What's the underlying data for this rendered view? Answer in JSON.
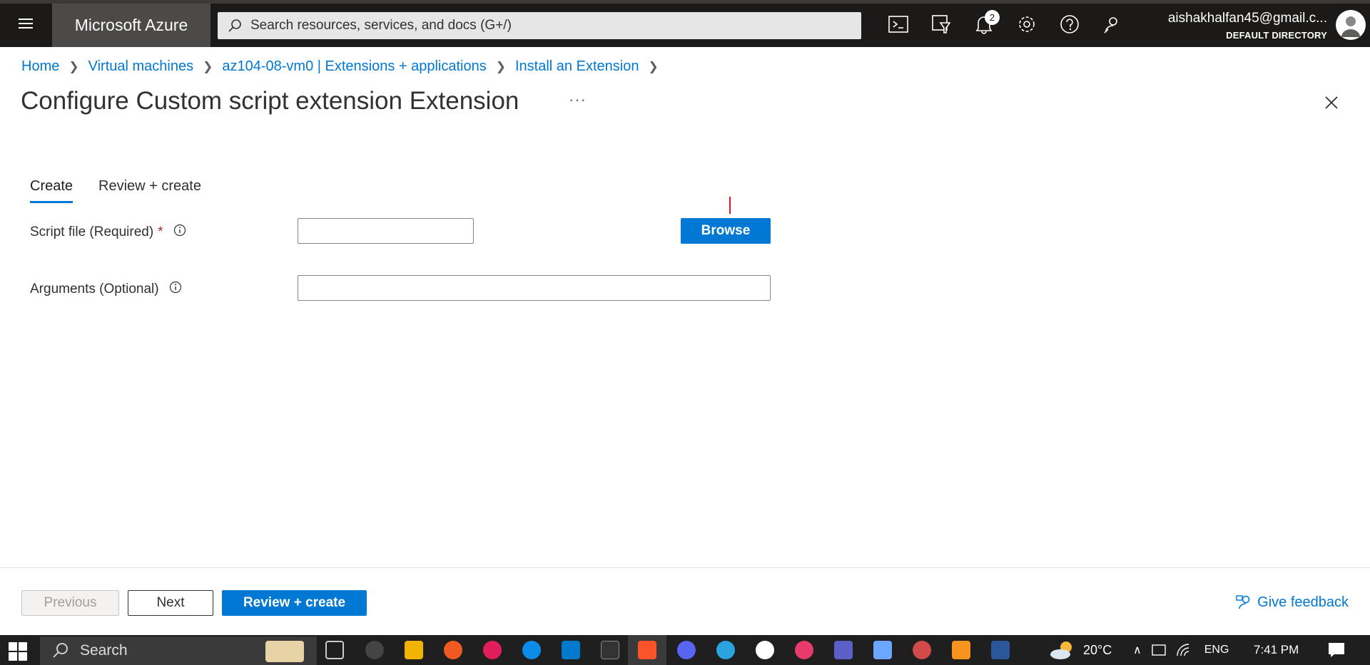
{
  "topbar": {
    "brand": "Microsoft Azure",
    "search_placeholder": "Search resources, services, and docs (G+/)",
    "notification_count": "2",
    "account_email": "aishakhalfan45@gmail.c...",
    "account_directory": "DEFAULT DIRECTORY"
  },
  "breadcrumb": {
    "items": [
      "Home",
      "Virtual machines",
      "az104-08-vm0 | Extensions + applications",
      "Install an Extension"
    ]
  },
  "page": {
    "title": "Configure Custom script extension Extension",
    "more": "···"
  },
  "tabs": [
    "Create",
    "Review + create"
  ],
  "form": {
    "script_file_label": "Script file (Required)",
    "required_mark": "*",
    "script_file_value": "",
    "browse_label": "Browse",
    "arguments_label": "Arguments (Optional)",
    "arguments_value": ""
  },
  "footer": {
    "previous_label": "Previous",
    "next_label": "Next",
    "review_label": "Review + create",
    "feedback_label": "Give feedback"
  },
  "taskbar": {
    "search_label": "Search",
    "weather": "20°C",
    "language": "ENG",
    "time": "7:41 PM"
  },
  "colors": {
    "accent": "#0078d4",
    "topbar": "#1b1a19",
    "required": "#a4262c"
  }
}
